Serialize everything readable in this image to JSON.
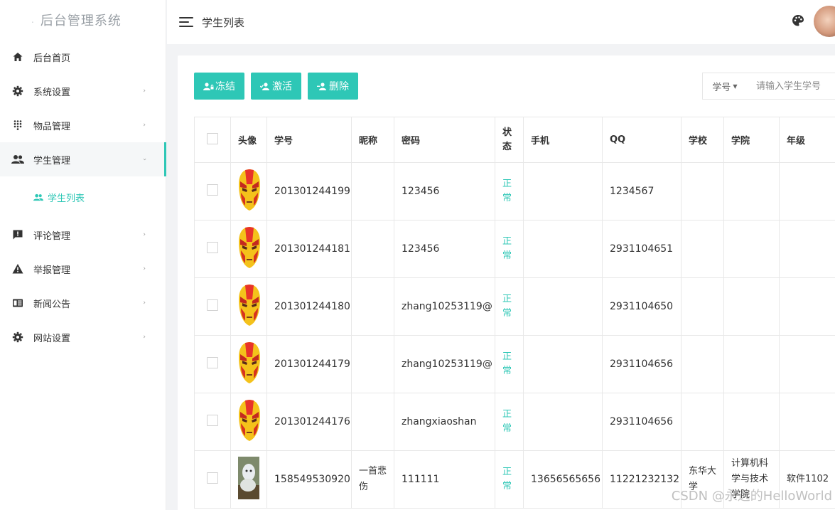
{
  "app": {
    "title": "后台管理系统"
  },
  "sidebar": {
    "items": [
      {
        "label": "后台首页",
        "icon": "home-icon",
        "arrow": ""
      },
      {
        "label": "系统设置",
        "icon": "gear-icon",
        "arrow": "›"
      },
      {
        "label": "物品管理",
        "icon": "apps-grid-icon",
        "arrow": "›"
      },
      {
        "label": "学生管理",
        "icon": "users-icon",
        "arrow": "›"
      },
      {
        "label": "评论管理",
        "icon": "comment-icon",
        "arrow": "›"
      },
      {
        "label": "举报管理",
        "icon": "warning-icon",
        "arrow": "›"
      },
      {
        "label": "新闻公告",
        "icon": "news-icon",
        "arrow": "›"
      },
      {
        "label": "网站设置",
        "icon": "gear-icon",
        "arrow": "›"
      }
    ],
    "sub_items": [
      {
        "label": "学生列表",
        "icon": "users-icon"
      }
    ]
  },
  "header": {
    "title": "学生列表"
  },
  "toolbar": {
    "freeze": "冻结",
    "activate": "激活",
    "delete": "删除",
    "search_field": "学号",
    "search_placeholder": "请输入学生学号"
  },
  "table": {
    "headers": [
      "头像",
      "学号",
      "昵称",
      "密码",
      "状态",
      "手机",
      "QQ",
      "学校",
      "学院",
      "年级"
    ],
    "rows": [
      {
        "avatar": "ironman",
        "id": "201301244199",
        "nickname": "",
        "password": "123456",
        "status": "正常",
        "phone": "",
        "qq": "1234567",
        "school": "",
        "college": "",
        "grade": ""
      },
      {
        "avatar": "ironman",
        "id": "201301244181",
        "nickname": "",
        "password": "123456",
        "status": "正常",
        "phone": "",
        "qq": "2931104651",
        "school": "",
        "college": "",
        "grade": ""
      },
      {
        "avatar": "ironman",
        "id": "201301244180",
        "nickname": "",
        "password": "zhang10253119@",
        "status": "正常",
        "phone": "",
        "qq": "2931104650",
        "school": "",
        "college": "",
        "grade": ""
      },
      {
        "avatar": "ironman",
        "id": "201301244179",
        "nickname": "",
        "password": "zhang10253119@",
        "status": "正常",
        "phone": "",
        "qq": "2931104656",
        "school": "",
        "college": "",
        "grade": ""
      },
      {
        "avatar": "ironman",
        "id": "201301244176",
        "nickname": "",
        "password": "zhangxiaoshan",
        "status": "正常",
        "phone": "",
        "qq": "2931104656",
        "school": "",
        "college": "",
        "grade": ""
      },
      {
        "avatar": "photo",
        "id": "158549530920",
        "nickname": "一首悲伤",
        "password": "111111",
        "status": "正常",
        "phone": "13656565656",
        "qq": "11221232132",
        "school": "东华大学",
        "college": "计算机科学与技术学院",
        "grade": "软件1102"
      }
    ]
  },
  "watermark": "CSDN @永远的HelloWorld",
  "colors": {
    "accent": "#2ec7b6"
  }
}
